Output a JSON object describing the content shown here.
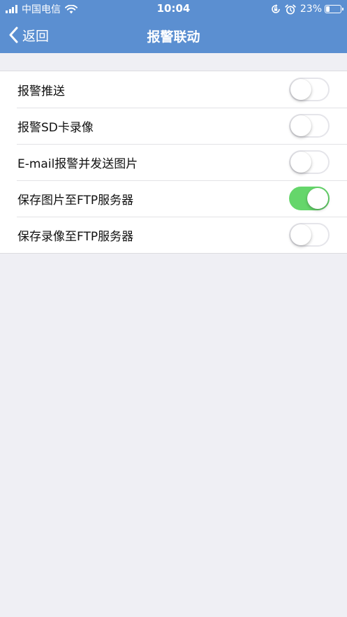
{
  "status_bar": {
    "carrier": "中国电信",
    "time": "10:04",
    "battery_percent_text": "23%",
    "battery_level": 0.23,
    "signal_icon": "cellular-signal-icon",
    "wifi_icon": "wifi-icon",
    "rotation_lock_icon": "rotation-lock-icon",
    "alarm_icon": "alarm-icon"
  },
  "nav": {
    "back_label": "返回",
    "back_icon": "chevron-left-icon",
    "title": "报警联动"
  },
  "settings": [
    {
      "label": "报警推送",
      "on": false
    },
    {
      "label": "报警SD卡录像",
      "on": false
    },
    {
      "label": "E-mail报警并发送图片",
      "on": false
    },
    {
      "label": "保存图片至FTP服务器",
      "on": true
    },
    {
      "label": "保存录像至FTP服务器",
      "on": false
    }
  ],
  "colors": {
    "nav_bar": "#5b8fd1",
    "background": "#efeff4",
    "toggle_on": "#65d66b"
  }
}
